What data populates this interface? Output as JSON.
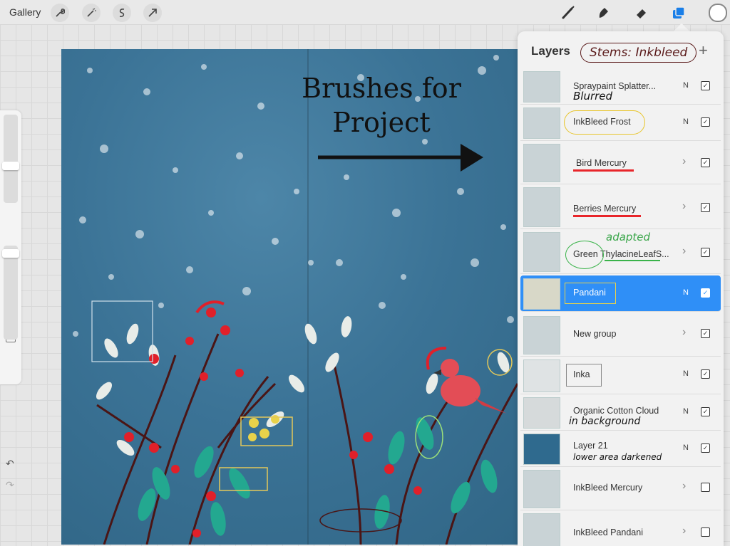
{
  "toolbar": {
    "gallery": "Gallery",
    "left_tools": [
      "wrench-icon",
      "magic-wand-icon",
      "selection-icon",
      "transform-arrow-icon"
    ],
    "right_tools": [
      "brush-icon",
      "smudge-icon",
      "eraser-icon",
      "layers-icon"
    ],
    "active_tool_color": "#1a7fe8"
  },
  "canvas": {
    "caption_line1": "Brushes for",
    "caption_line2": "Project",
    "background_color": "#3b7396"
  },
  "layers_panel": {
    "title": "Layers",
    "add": "+",
    "title_annotation": "Stems: Inkbleed",
    "layers": [
      {
        "name": "Spraypaint Splatter...",
        "blend": "N",
        "visible": true,
        "annotation": "Blurred"
      },
      {
        "name": "InkBleed Frost",
        "blend": "N",
        "visible": true
      },
      {
        "name": "Bird Mercury",
        "group": true,
        "visible": true
      },
      {
        "name": "Berries Mercury",
        "group": true,
        "visible": true
      },
      {
        "name": "Green  ThylacineLeafS...",
        "group": true,
        "visible": true,
        "annotation": "adapted"
      },
      {
        "name": "Pandani",
        "blend": "N",
        "visible": true,
        "active": true
      },
      {
        "name": "New group",
        "group": true,
        "visible": true
      },
      {
        "name": "Inka",
        "blend": "N",
        "visible": true
      },
      {
        "name": "Organic Cotton Cloud",
        "blend": "N",
        "visible": true,
        "annotation": "in background"
      },
      {
        "name": "Layer 21",
        "blend": "N",
        "visible": true,
        "annotation": "lower area darkened"
      },
      {
        "name": "InkBleed Mercury",
        "group": true,
        "visible": false
      },
      {
        "name": "InkBleed Pandani",
        "group": true,
        "visible": false
      }
    ],
    "active_color": "#2f8ff7"
  },
  "sidebar": {
    "undo": "↶",
    "redo": "↷"
  }
}
